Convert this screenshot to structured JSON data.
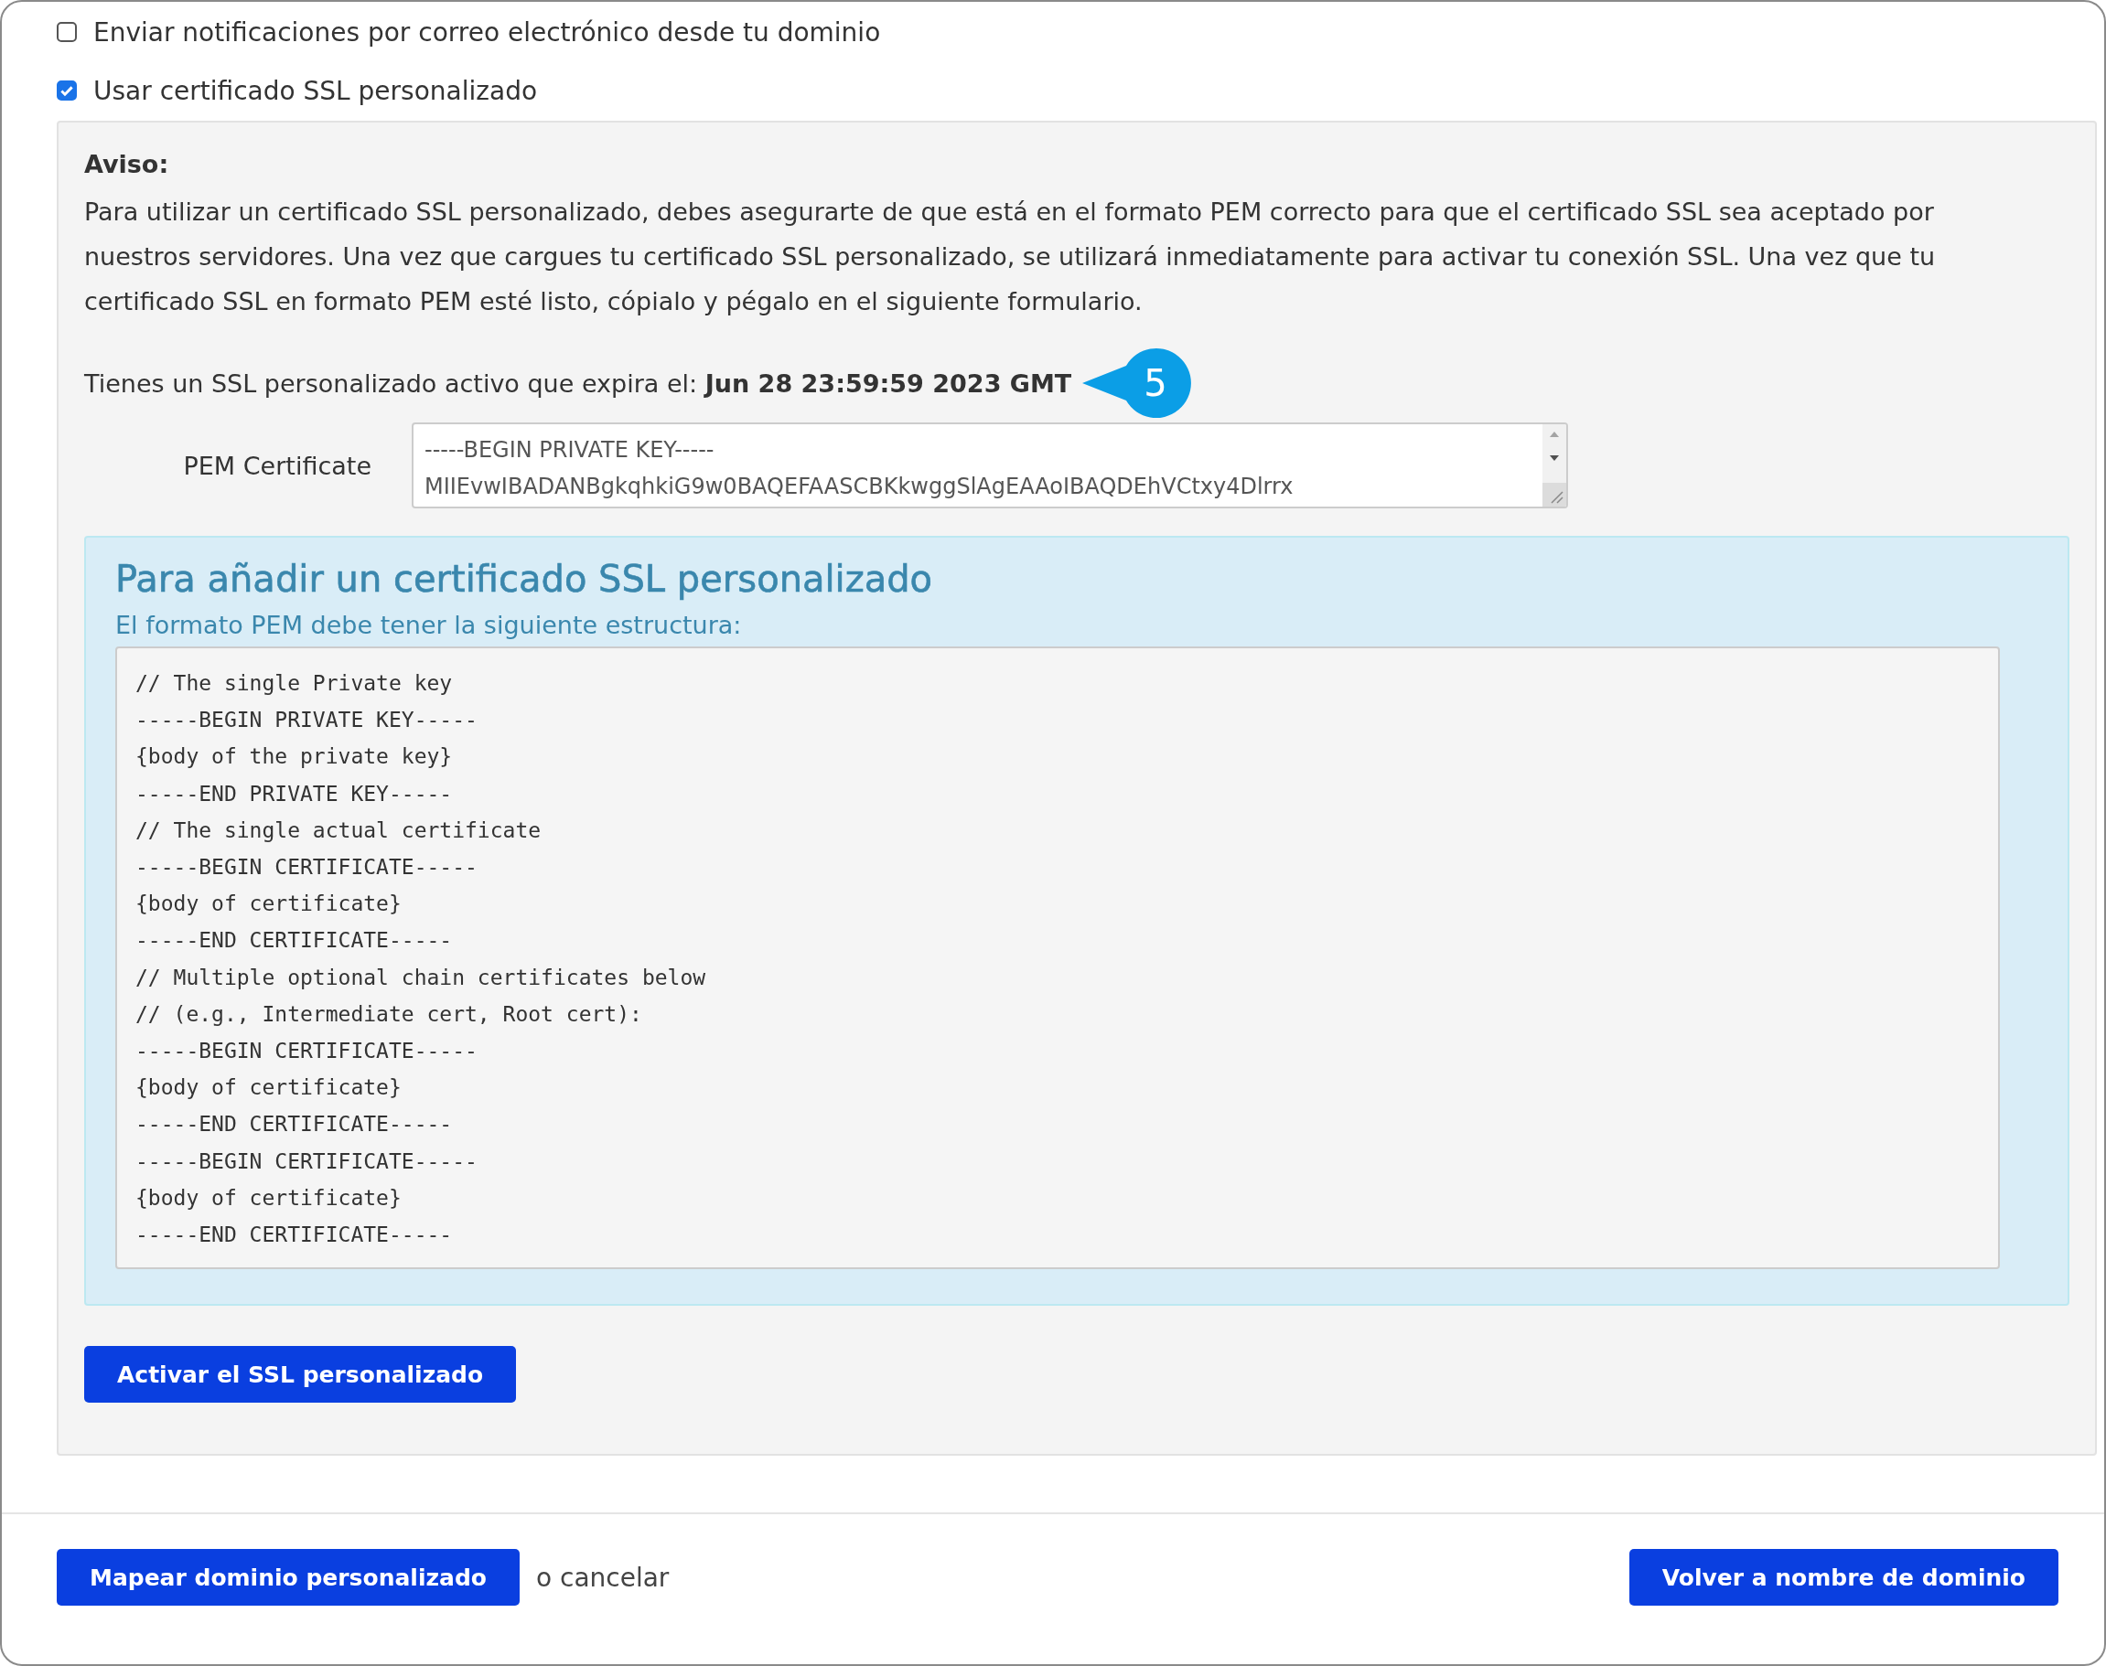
{
  "options": [
    {
      "label": "Enviar notificaciones por correo electrónico desde tu dominio",
      "checked": false
    },
    {
      "label": "Usar certificado SSL personalizado",
      "checked": true
    }
  ],
  "notice": {
    "title": "Aviso:",
    "text": "Para utilizar un certificado SSL personalizado, debes asegurarte de que está en el formato PEM correcto para que el certificado SSL sea aceptado por nuestros servidores. Una vez que cargues tu certificado SSL personalizado, se utilizará inmediatamente para activar tu conexión SSL. Una vez que tu certificado SSL en formato PEM esté listo, cópialo y pégalo en el siguiente formulario."
  },
  "expiry": {
    "text": "Tienes un SSL personalizado activo que expira el: **Jun 28 23:59:59 2023 GMT**",
    "callout": "5"
  },
  "pem_field": {
    "label": "PEM Certificate",
    "value": [
      "-----BEGIN PRIVATE KEY-----",
      "MIIEvwIBADANBgkqhkiG9w0BAQEFAASCBKkwggSlAgEAAoIBAQDEhVCtxy4Dlrrx"
    ]
  },
  "info": {
    "title": "Para añadir un certificado SSL personalizado",
    "subtitle": "El formato PEM debe tener la siguiente estructura:",
    "code": [
      "// The single Private key",
      "-----BEGIN PRIVATE KEY-----",
      "{body of the private key}",
      "-----END PRIVATE KEY-----",
      "// The single actual certificate",
      "-----BEGIN CERTIFICATE-----",
      "{body of certificate}",
      "-----END CERTIFICATE-----",
      "// Multiple optional chain certificates below",
      "// (e.g., Intermediate cert, Root cert):",
      "-----BEGIN CERTIFICATE-----",
      "{body of certificate}",
      "-----END CERTIFICATE-----",
      "-----BEGIN CERTIFICATE-----",
      "{body of certificate}",
      "-----END CERTIFICATE-----"
    ]
  },
  "activate_button": "Activar el SSL personalizado",
  "footer": {
    "primary_button": "Mapear dominio personalizado",
    "cancel_text": "o cancelar",
    "back_button": "Volver a nombre de dominio"
  }
}
